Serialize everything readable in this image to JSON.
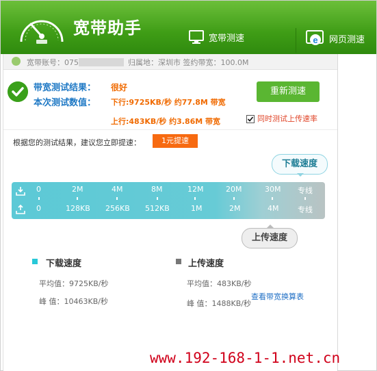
{
  "app": {
    "title": "宽带助手"
  },
  "nav": [
    {
      "label": "宽带测速"
    },
    {
      "label": "网页测速"
    }
  ],
  "account": {
    "text_prefix": "宽带账号：075",
    "text_suffix": "归属地：深圳市  签约带宽：100.0M"
  },
  "result": {
    "test_result_label": "带宽测试结果：",
    "test_result_value": "很好",
    "test_value_label": "本次测试数值：",
    "download_text": "下行:9725KB/秒 约77.8M 带宽",
    "upload_text": "上行:483KB/秒 约3.86M 带宽",
    "retest_label": "重新测速",
    "upload_option_label": "同时测试上传速率",
    "upload_option_checked": true
  },
  "suggestion": {
    "text": "根据您的测试结果，建议您立即提速：",
    "button_label": "1元提速"
  },
  "meter": {
    "download_tip": "下载速度",
    "upload_tip": "上传速度",
    "download_ticks": [
      "0",
      "2M",
      "4M",
      "8M",
      "12M",
      "20M",
      "30M",
      "专线"
    ],
    "upload_ticks": [
      "0",
      "128KB",
      "256KB",
      "512KB",
      "1M",
      "2M",
      "4M",
      "专线"
    ]
  },
  "stats": {
    "download": {
      "title": "下载速度",
      "avg": "平均值：9725KB/秒",
      "peak": "峰  值：10463KB/秒",
      "color": "#28c8d8"
    },
    "upload": {
      "title": "上传速度",
      "avg": "平均值：483KB/秒",
      "peak": "峰  值：1488KB/秒",
      "color": "#777777"
    }
  },
  "link_label": "查看带宽换算表",
  "watermark": "www.192-168-1-1.net.cn"
}
